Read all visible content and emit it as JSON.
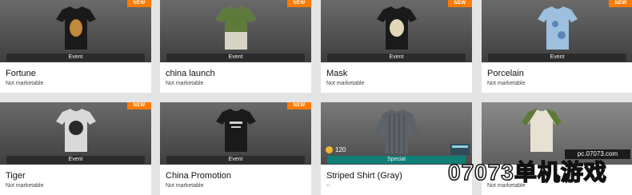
{
  "cards": [
    {
      "name": "Fortune",
      "status": "Not marketable",
      "badge": "NEW",
      "tag": "Event"
    },
    {
      "name": "china launch",
      "status": "Not marketable",
      "badge": "NEW",
      "tag": "Event"
    },
    {
      "name": "Mask",
      "status": "Not marketable",
      "badge": "NEW",
      "tag": "Event"
    },
    {
      "name": "Porcelain",
      "status": "Not marketable",
      "badge": "NEW",
      "tag": "Event"
    },
    {
      "name": "Tiger",
      "status": "Not marketable",
      "badge": "NEW",
      "tag": "Event"
    },
    {
      "name": "China Promotion",
      "status": "Not marketable",
      "badge": "NEW",
      "tag": "Event"
    },
    {
      "name": "Striped Shirt (Gray)",
      "status": "--",
      "tag": "Special",
      "price": "120"
    },
    {
      "name": "",
      "status": "Not marketable"
    }
  ],
  "watermark": {
    "site": "pc.07073.com",
    "text": "07073单机游戏"
  },
  "colors": {
    "new_badge": "#ff7a00",
    "special_banner": "#0f7e77",
    "event_banner": "#2b2b2b",
    "coin": "#f2b631"
  }
}
